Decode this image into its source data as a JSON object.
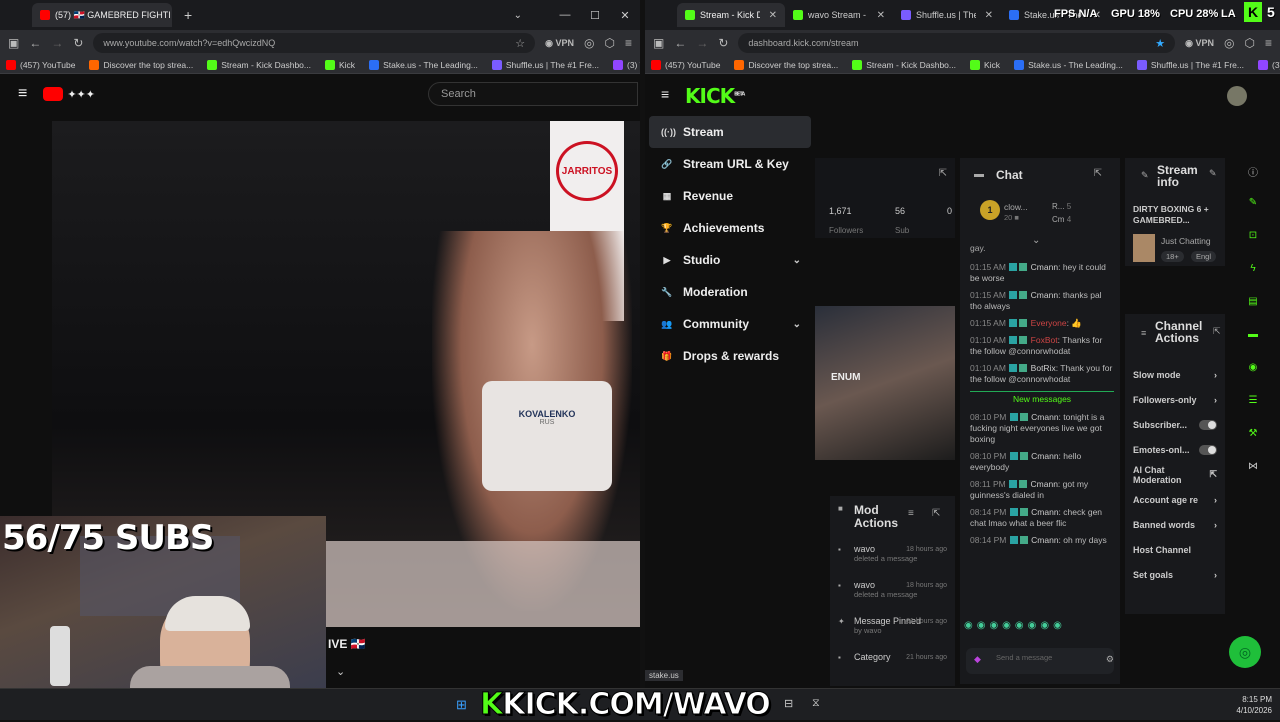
{
  "left_browser": {
    "tab_title": "(57) 🇩🇴 GAMEBRED FIGHTI",
    "new_tab": "+",
    "url": "www.youtube.com/watch?v=edhQwcizdNQ",
    "vpn": "VPN",
    "bookmarks": [
      "(457) YouTube",
      "Discover the top strea...",
      "Stream - Kick Dashbo...",
      "Kick",
      "Stake.us - The Leading...",
      "Shuffle.us | The #1 Fre...",
      "(3) Twitch"
    ],
    "search_placeholder": "Search",
    "sponsor_text": "JARRITOS",
    "shorts_text": "KOVALENKO",
    "shorts_sub": "RUS",
    "live_text": "IVE 🇩🇴"
  },
  "webcam": {
    "subs_text": "56/75 SUBS"
  },
  "right_browser": {
    "tabs": [
      {
        "title": "Stream - Kick D",
        "color": "#53fc18",
        "active": true
      },
      {
        "title": "wavo Stream -",
        "color": "#53fc18",
        "active": false
      },
      {
        "title": "Shuffle.us | The #1",
        "color": "#7a5cff",
        "active": false
      },
      {
        "title": "Stake.us - The",
        "color": "#2b6ef5",
        "active": false
      }
    ],
    "url": "dashboard.kick.com/stream",
    "vpn": "VPN",
    "bookmarks": [
      "(457) YouTube",
      "Discover the top strea...",
      "Stream - Kick Dashbo...",
      "Kick",
      "Stake.us - The Leading...",
      "Shuffle.us | The #1 Fre...",
      "(3) Twitch"
    ],
    "status_url": "stake.us"
  },
  "perf_overlay": {
    "fps": "FPS N/A",
    "gpu": "GPU 18%",
    "cpu": "CPU 28%",
    "extra": "LA",
    "corner_num": "5"
  },
  "kick": {
    "logo": "KICK",
    "logo_sup": "BETA",
    "sidebar": [
      {
        "icon": "stream-icon",
        "glyph": "((·))",
        "label": "Stream",
        "active": true,
        "expand": false
      },
      {
        "icon": "link-icon",
        "glyph": "🔗",
        "label": "Stream URL & Key",
        "active": false,
        "expand": false
      },
      {
        "icon": "revenue-icon",
        "glyph": "▦",
        "label": "Revenue",
        "active": false,
        "expand": false
      },
      {
        "icon": "trophy-icon",
        "glyph": "🏆",
        "label": "Achievements",
        "active": false,
        "expand": false
      },
      {
        "icon": "studio-icon",
        "glyph": "▶",
        "label": "Studio",
        "active": false,
        "expand": true
      },
      {
        "icon": "wrench-icon",
        "glyph": "🔧",
        "label": "Moderation",
        "active": false,
        "expand": false
      },
      {
        "icon": "community-icon",
        "glyph": "👥",
        "label": "Community",
        "active": false,
        "expand": true
      },
      {
        "icon": "gift-icon",
        "glyph": "🎁",
        "label": "Drops & rewards",
        "active": false,
        "expand": false
      }
    ],
    "stats": {
      "followers_value": "1,671",
      "followers_label": "Followers",
      "subs_value": "56",
      "subs_label": "Sub",
      "third_value": "0"
    },
    "preview_caption": "ENUM",
    "chat": {
      "title": "Chat",
      "pinned_user": "clow...",
      "pinned_sub": "20 ■",
      "top_users": [
        {
          "name": "R...",
          "count": "5"
        },
        {
          "name": "Cm",
          "count": "4"
        }
      ],
      "fragment": "gay.",
      "messages_before": [
        {
          "time": "01:15 AM",
          "user": "Cmann",
          "text": "hey it could be worse"
        },
        {
          "time": "01:15 AM",
          "user": "Cmann",
          "text": "thanks pal tho always"
        },
        {
          "time": "01:15 AM",
          "user": "Everyone",
          "text": "👍"
        },
        {
          "time": "01:10 AM",
          "user": "FoxBot",
          "text": "Thanks for the follow @connorwhodat"
        },
        {
          "time": "01:10 AM",
          "user": "BotRix",
          "text": "Thank you for the follow @connorwhodat"
        }
      ],
      "new_messages": "New messages",
      "messages_after": [
        {
          "time": "08:10 PM",
          "user": "Cmann",
          "text": "tonight is a fucking night everyones live we got boxing"
        },
        {
          "time": "08:10 PM",
          "user": "Cmann",
          "text": "hello everybody"
        },
        {
          "time": "08:11 PM",
          "user": "Cmann",
          "text": "got my guinness's dialed in"
        },
        {
          "time": "08:14 PM",
          "user": "Cmann",
          "text": "check gen chat lmao what a beer flic"
        },
        {
          "time": "08:14 PM",
          "user": "Cmann",
          "text": "oh my days"
        }
      ],
      "input_placeholder": "Send a message"
    },
    "stream_info": {
      "title": "Stream info",
      "stream_title": "DIRTY BOXING 6 + GAMEBRED...",
      "category": "Just Chatting",
      "tag1": "18+",
      "tag2": "Engl"
    },
    "channel_actions": {
      "title": "Channel Actions",
      "items": [
        {
          "label": "Slow mode",
          "control": "arrow"
        },
        {
          "label": "Followers-only",
          "control": "arrow"
        },
        {
          "label": "Subscriber...",
          "control": "toggle"
        },
        {
          "label": "Emotes-onl...",
          "control": "toggle"
        },
        {
          "label": "AI Chat Moderation",
          "control": "link"
        },
        {
          "label": "Account age re",
          "control": "arrow"
        },
        {
          "label": "Banned words",
          "control": "arrow"
        },
        {
          "label": "Host Channel",
          "control": "none"
        },
        {
          "label": "Set goals",
          "control": "arrow"
        }
      ]
    },
    "mod_actions": {
      "title": "Mod Actions",
      "rows": [
        {
          "user": "wavo",
          "action": "deleted a message",
          "time": "18 hours ago"
        },
        {
          "user": "wavo",
          "action": "deleted a message",
          "time": "18 hours ago"
        },
        {
          "user": "Message Pinned",
          "action": "by wavo",
          "time": "21 hours ago"
        },
        {
          "user": "Category",
          "action": "",
          "time": "21 hours ago"
        }
      ]
    }
  },
  "taskbar": {
    "banner_k": "K",
    "banner_text": "KICK.COM/WAVO",
    "time": "8:15 PM",
    "date": "4/10/2026"
  },
  "colors": {
    "kick_green": "#53fc18",
    "panel_bg": "#18191c",
    "page_bg": "#0f0f0f"
  }
}
